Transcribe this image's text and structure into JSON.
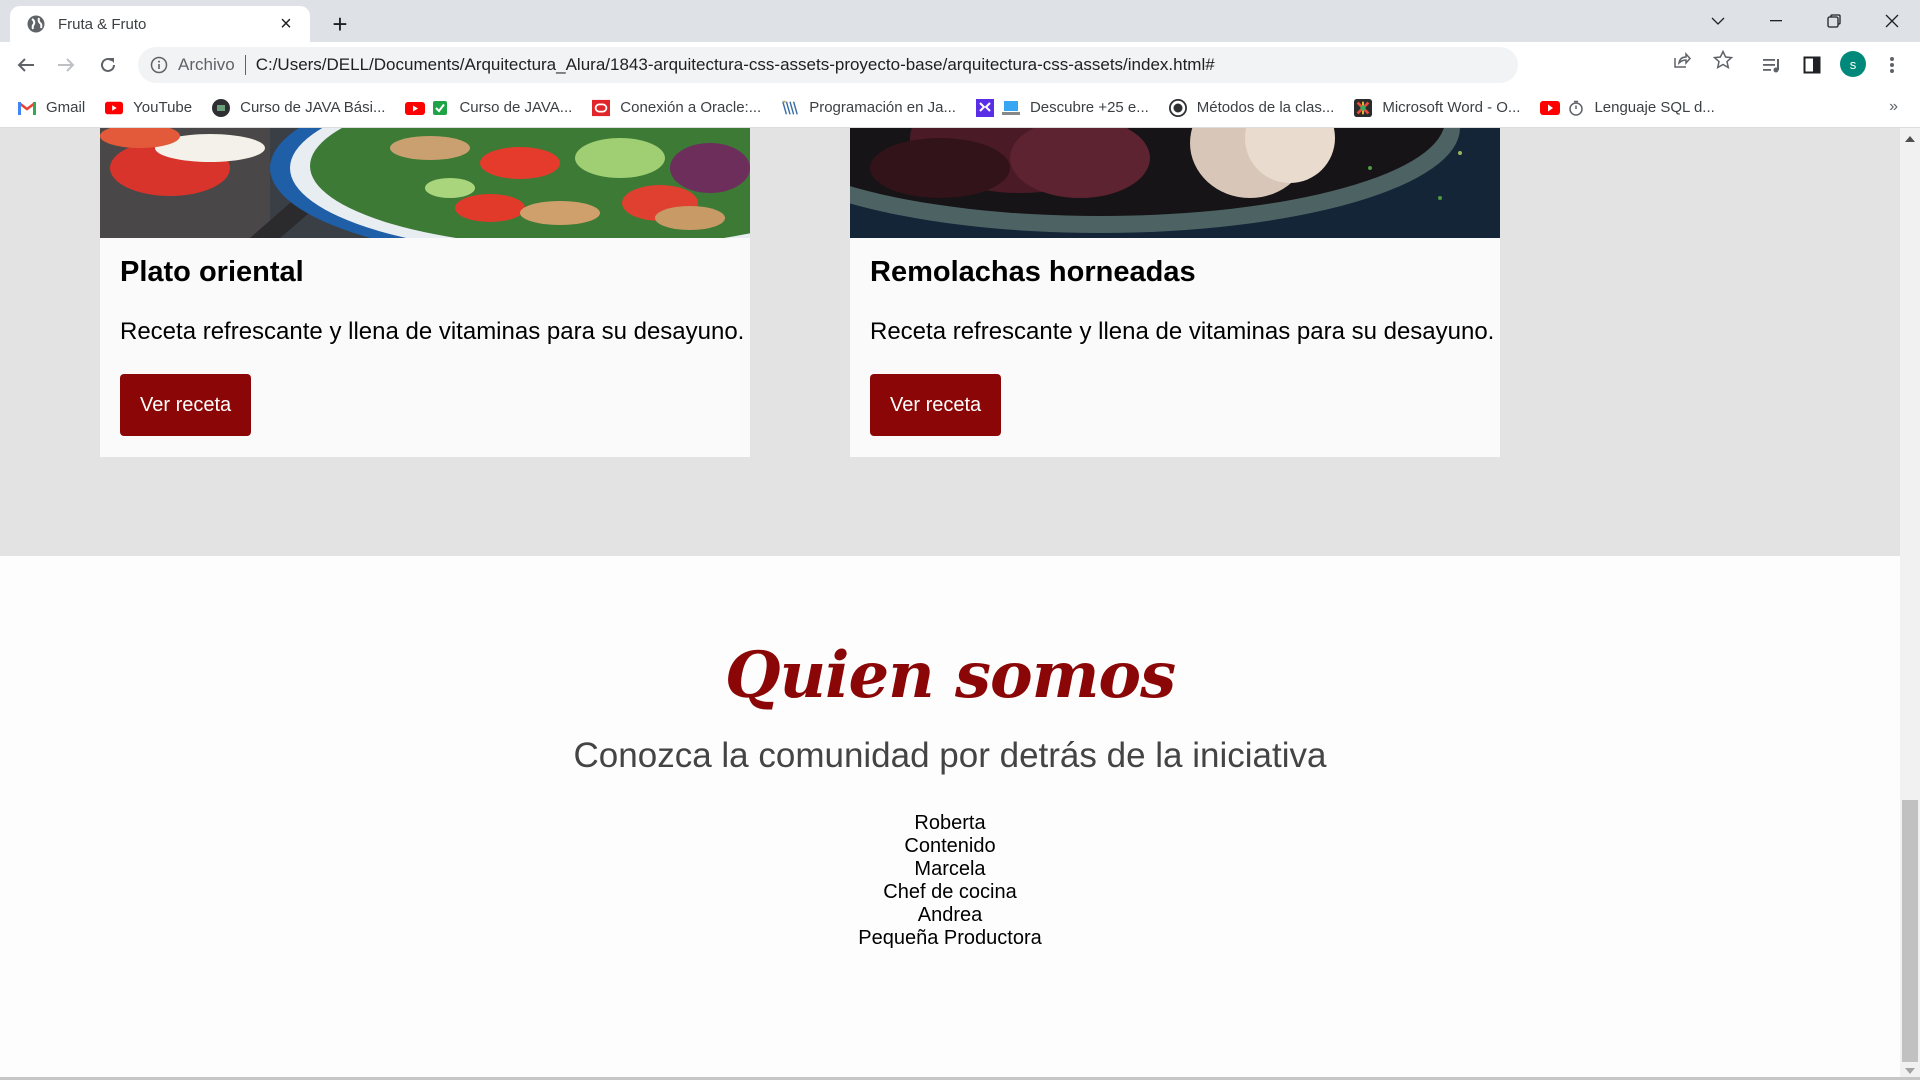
{
  "browser": {
    "tab": {
      "title": "Fruta & Fruto",
      "favicon": "globe-icon"
    },
    "new_tab_icon": "plus-icon",
    "window_controls": [
      "tab-search-icon",
      "minimize-icon",
      "restore-icon",
      "close-icon"
    ],
    "address": {
      "scheme_label": "Archivo",
      "url": "C:/Users/DELL/Documents/Arquitectura_Alura/1843-arquitectura-css-assets-proyecto-base/arquitectura-css-assets/index.html#"
    },
    "profile_initial": "s",
    "bookmarks": [
      {
        "label": "Gmail",
        "icon": "gmail-icon"
      },
      {
        "label": "YouTube",
        "icon": "youtube-icon"
      },
      {
        "label": "Curso de JAVA Bási...",
        "icon": "course-icon"
      },
      {
        "label": "Curso de JAVA...",
        "icon": "youtube-check-icon"
      },
      {
        "label": "Conexión a Oracle:...",
        "icon": "oracle-icon"
      },
      {
        "label": "Programación en Ja...",
        "icon": "books-icon"
      },
      {
        "label": "Descubre +25 e...",
        "icon": "laptop-icon"
      },
      {
        "label": "Métodos de la clas...",
        "icon": "github-icon"
      },
      {
        "label": "Microsoft Word - O...",
        "icon": "word-icon"
      },
      {
        "label": "Lenguaje SQL d...",
        "icon": "youtube-timer-icon"
      }
    ],
    "bookmarks_more": "»"
  },
  "recipes": [
    {
      "title": "Plato oriental",
      "description": "Receta refrescante y llena de vitaminas para su desayuno.",
      "button": "Ver receta",
      "image": "salad-photo"
    },
    {
      "title": "Remolachas horneadas",
      "description": "Receta refrescante y llena de vitaminas para su desayuno.",
      "button": "Ver receta",
      "image": "beets-photo"
    }
  ],
  "about": {
    "title": "Quien somos",
    "subtitle": "Conozca la comunidad por detrás de la iniciativa",
    "members": [
      {
        "name": "Roberta",
        "role": "Contenido"
      },
      {
        "name": "Marcela",
        "role": "Chef de cocina"
      },
      {
        "name": "Andrea",
        "role": "Pequeña Productora"
      }
    ]
  },
  "colors": {
    "accent": "#8b0606",
    "recipes_bg": "#e3e3e3",
    "card_bg": "#fafafa",
    "profile": "#00897b"
  }
}
